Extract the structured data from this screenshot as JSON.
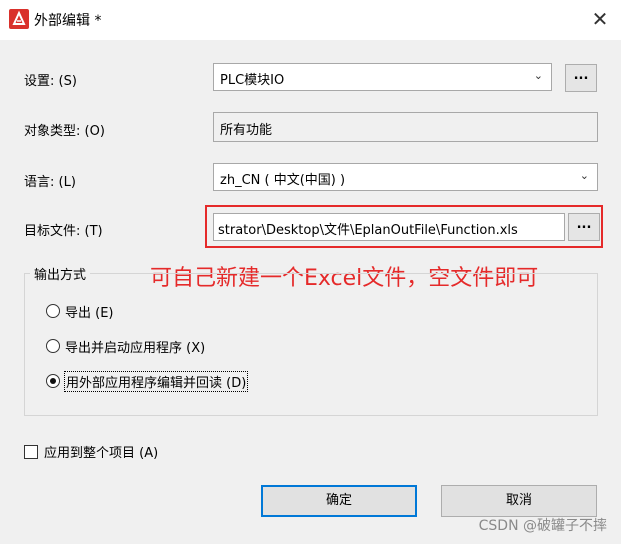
{
  "window": {
    "title": "外部编辑 *",
    "close_glyph": "✕"
  },
  "settings": {
    "label": "设置: (S)",
    "value": "PLC模块IO",
    "browse_label": "..."
  },
  "object_type": {
    "label": "对象类型: (O)",
    "value": "所有功能"
  },
  "language": {
    "label": "语言: (L)",
    "value": "zh_CN ( 中文(中国) )"
  },
  "target_file": {
    "label": "目标文件: (T)",
    "value": "strator\\Desktop\\文件\\EplanOutFile\\Function.xls",
    "browse_label": "..."
  },
  "annotation": "可自己新建一个Excel文件，空文件即可",
  "output_mode": {
    "title": "输出方式",
    "options": [
      {
        "label": "导出 (E)",
        "checked": false
      },
      {
        "label": "导出并启动应用程序 (X)",
        "checked": false
      },
      {
        "label": "用外部应用程序编辑并回读 (D)",
        "checked": true
      }
    ]
  },
  "apply_all": {
    "label": "应用到整个项目 (A)",
    "checked": false
  },
  "buttons": {
    "ok": "确定",
    "cancel": "取消"
  },
  "watermark": "CSDN @破罐子不摔",
  "colors": {
    "accent": "#0078d7",
    "annotation_red": "#e52a2a",
    "app_icon": "#d9312b"
  },
  "icons": {
    "app": "eplan-app-icon",
    "dropdown": "chevron-down-icon",
    "close": "close-icon"
  }
}
